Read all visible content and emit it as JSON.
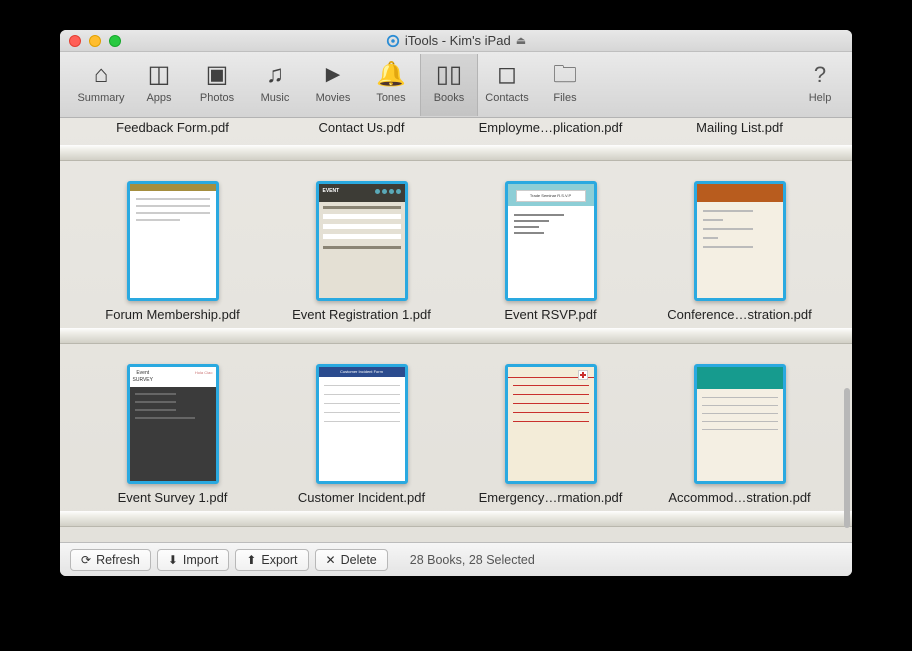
{
  "window": {
    "title": "iTools - Kim's iPad"
  },
  "toolbar": {
    "items": [
      {
        "id": "summary",
        "label": "Summary",
        "icon": "⌂"
      },
      {
        "id": "apps",
        "label": "Apps",
        "icon": "◫"
      },
      {
        "id": "photos",
        "label": "Photos",
        "icon": "▣"
      },
      {
        "id": "music",
        "label": "Music",
        "icon": "♫"
      },
      {
        "id": "movies",
        "label": "Movies",
        "icon": "►"
      },
      {
        "id": "tones",
        "label": "Tones",
        "icon": "🔔"
      },
      {
        "id": "books",
        "label": "Books",
        "icon": "▯▯",
        "selected": true
      },
      {
        "id": "contacts",
        "label": "Contacts",
        "icon": "◻"
      },
      {
        "id": "files",
        "label": "Files",
        "icon": "🗀"
      }
    ],
    "help": {
      "label": "Help",
      "icon": "?"
    }
  },
  "partial_row": [
    {
      "label": "Feedback Form.pdf"
    },
    {
      "label": "Contact Us.pdf"
    },
    {
      "label": "Employme…plication.pdf"
    },
    {
      "label": "Mailing List.pdf"
    }
  ],
  "rows": [
    [
      {
        "label": "Forum Membership.pdf",
        "pv": "forum"
      },
      {
        "label": "Event Registration 1.pdf",
        "pv": "eventreg"
      },
      {
        "label": "Event RSVP.pdf",
        "pv": "rsvp"
      },
      {
        "label": "Conference…stration.pdf",
        "pv": "conf"
      }
    ],
    [
      {
        "label": "Event Survey 1.pdf",
        "pv": "survey"
      },
      {
        "label": "Customer Incident.pdf",
        "pv": "incident"
      },
      {
        "label": "Emergency…rmation.pdf",
        "pv": "emerg"
      },
      {
        "label": "Accommod…stration.pdf",
        "pv": "accom"
      }
    ]
  ],
  "buttons": {
    "refresh": "Refresh",
    "import": "Import",
    "export": "Export",
    "delete": "Delete"
  },
  "status": "28 Books, 28 Selected",
  "colors": {
    "selection": "#2aa9e0"
  }
}
